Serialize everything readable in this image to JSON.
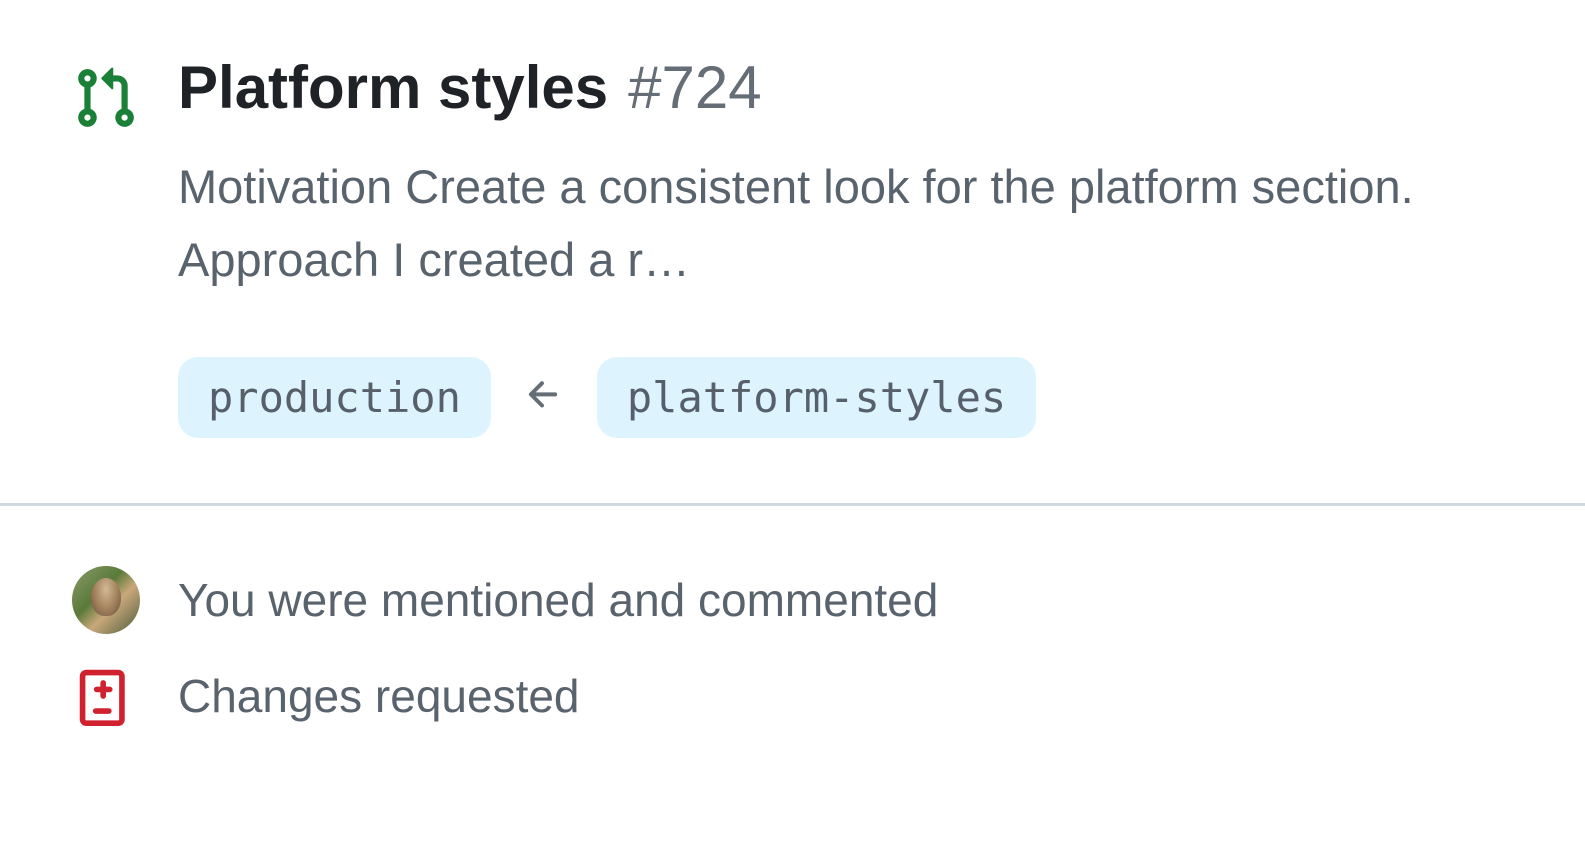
{
  "pr": {
    "title": "Platform styles",
    "number": "#724",
    "description": "Motivation Create a consistent look for the platform section. Approach I created a r…",
    "base_branch": "production",
    "head_branch": "platform-styles"
  },
  "meta": {
    "mention_text": "You were mentioned and commented",
    "review_status": "Changes requested"
  },
  "colors": {
    "pr_open_icon": "#1a7f37",
    "changes_requested_icon": "#cf222e",
    "branch_bg": "#ddf4ff",
    "text_muted": "#59636e",
    "border": "#d1d9e0"
  }
}
